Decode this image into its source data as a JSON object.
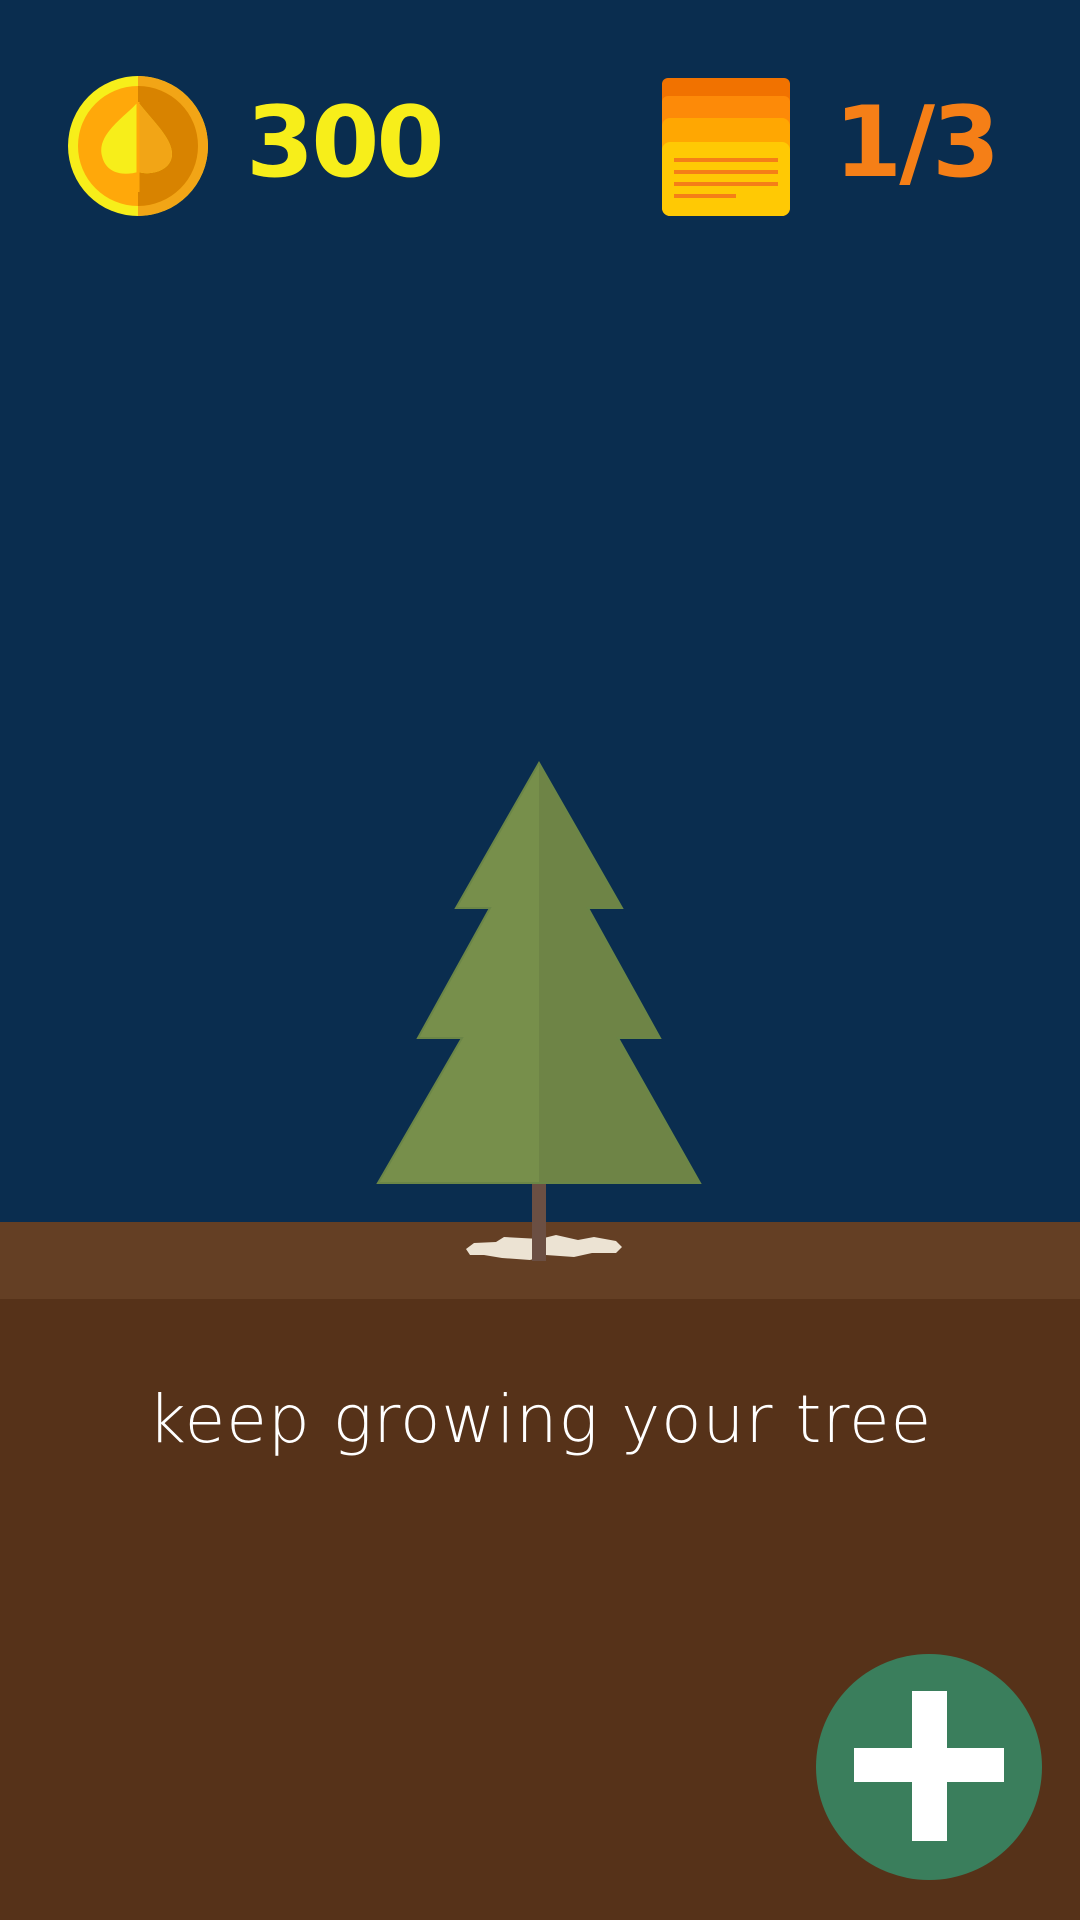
{
  "hud": {
    "coins": "300",
    "coin_icon": "leaf-coin-icon",
    "progress": "1/3",
    "progress_icon": "notes-stack-icon"
  },
  "main": {
    "message": "keep growing your tree"
  },
  "actions": {
    "add_icon": "plus-icon"
  },
  "colors": {
    "sky": "#0a2d4f",
    "ground": "#563219",
    "ground_top": "#643f24",
    "coin_text": "#f7ee1a",
    "progress_text": "#f57f17",
    "tree_left": "#778f4b",
    "tree_right": "#6e8446",
    "add_button": "#3a7e5c"
  }
}
